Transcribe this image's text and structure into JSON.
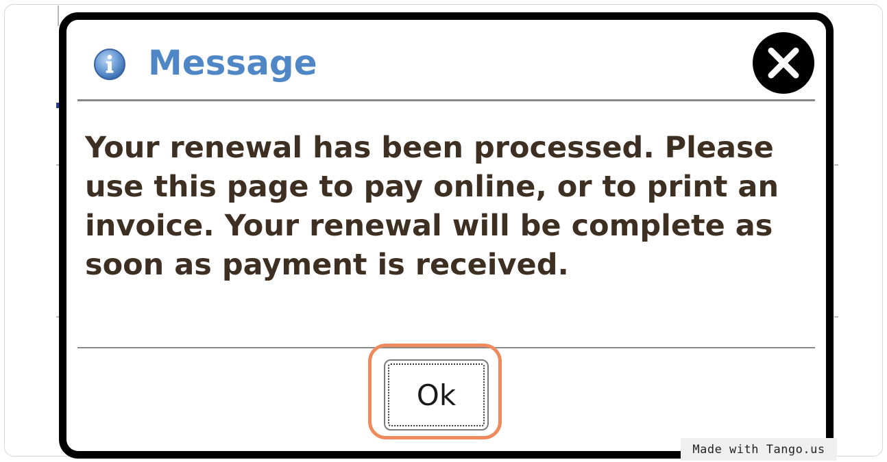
{
  "dialog": {
    "title": "Message",
    "message": "Your renewal has been processed. Please use this page to pay online, or to print an invoice. Your renewal will be complete as soon as payment is received.",
    "ok_label": "Ok",
    "icons": {
      "title_icon": "info-icon",
      "close_icon": "close-icon"
    }
  },
  "watermark": "Made with Tango.us",
  "colors": {
    "title": "#4f86c6",
    "message_text": "#3d2f22",
    "dialog_border": "#000000",
    "ok_highlight": "#f08a5d"
  }
}
